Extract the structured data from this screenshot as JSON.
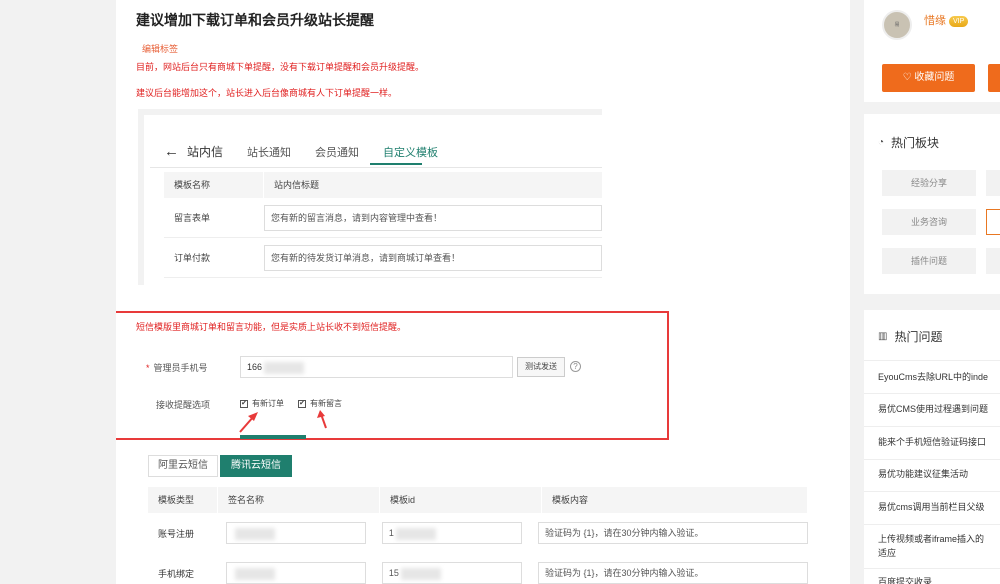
{
  "post": {
    "title": "建议增加下载订单和会员升级站长提醒",
    "edit_tag": "编辑标签",
    "para1": "目前，网站后台只有商城下单提醒，没有下载订单提醒和会员升级提醒。",
    "para2": "建议后台能增加这个，站长进入后台像商城有人下订单提醒一样。"
  },
  "inbox_shot": {
    "back_icon": "arrow-left-icon",
    "title": "站内信",
    "tabs": [
      "站长通知",
      "会员通知",
      "自定义模板"
    ],
    "active_tab": "自定义模板",
    "columns": [
      "模板名称",
      "站内信标题"
    ],
    "rows": [
      {
        "name": "留言表单",
        "title": "您有新的留言消息，请到内容管理中查看！"
      },
      {
        "name": "订单付款",
        "title": "您有新的待发货订单消息，请到商城订单查看！"
      }
    ]
  },
  "sms_shot": {
    "note": "短信模版里商城订单和留言功能，但是实质上站长收不到短信提醒。",
    "required_mark": "*",
    "phone_label": "管理员手机号",
    "phone_value": "166",
    "test_button": "测试发送",
    "help_icon": "question-circle-icon",
    "help_glyph": "?",
    "remind_label": "接收提醒选项",
    "options": [
      "有新订单",
      "有新留言"
    ],
    "check_glyph": "✔",
    "providers": [
      "阿里云短信",
      "腾讯云短信"
    ],
    "active_provider": "腾讯云短信",
    "columns": [
      "模板类型",
      "签名名称",
      "模板id",
      "模板内容"
    ],
    "rows": [
      {
        "type": "账号注册",
        "sign": "",
        "tpl_id": "1",
        "content": "验证码为 {1}，请在30分钟内输入验证。"
      },
      {
        "type": "手机绑定",
        "sign": "",
        "tpl_id": "15",
        "content": "验证码为 {1}，请在30分钟内输入验证。"
      }
    ]
  },
  "sidebar": {
    "avatar_text": "易",
    "username": "惜缘",
    "badge": "VIP",
    "favorite_button": "收藏问题",
    "heart_icon": "heart-icon",
    "hot_boards_title": "热门板块",
    "hot_boards_icon": "clock-icon",
    "boards": [
      "经验分享",
      "业务咨询",
      "插件问题"
    ],
    "hot_questions_title": "热门问题",
    "hot_questions_icon": "chart-icon",
    "questions": [
      "EyouCms去除URL中的inde",
      "易优CMS使用过程遇到问题",
      "能来个手机短信验证码接口",
      "易优功能建议征集活动",
      "易优cms调用当前栏目父级",
      "上传视频或者iframe插入的",
      "适应",
      "百度提交收录"
    ]
  },
  "colors": {
    "accent_green": "#1f7f6e",
    "accent_orange": "#ef6b1c",
    "highlight_red": "#e83a3a"
  }
}
